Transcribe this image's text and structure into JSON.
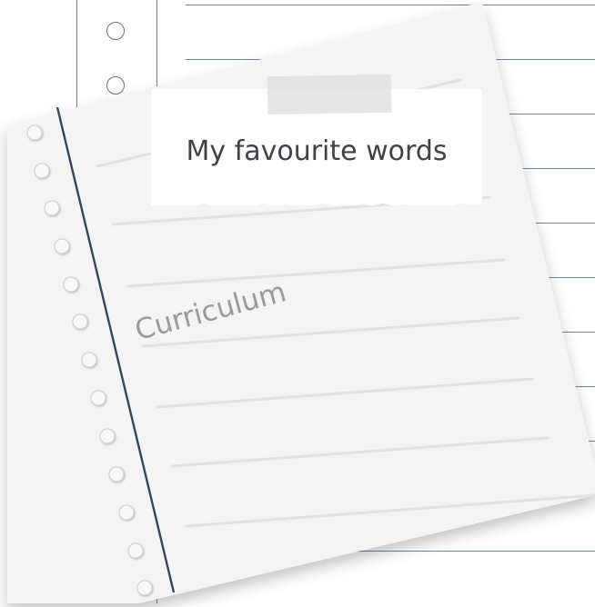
{
  "note": {
    "title": "My favourite words",
    "subtitle": "Curriculum"
  },
  "decorations": {
    "background_page_icon": "notebook-page-icon",
    "hole_icon": "hole-punch-icon",
    "tape_icon": "tape-icon"
  },
  "colors": {
    "paper": "#f4f4f4",
    "background_lines": "#758596",
    "margin_line": "#33475f",
    "muted_text": "#9a9a9a"
  }
}
